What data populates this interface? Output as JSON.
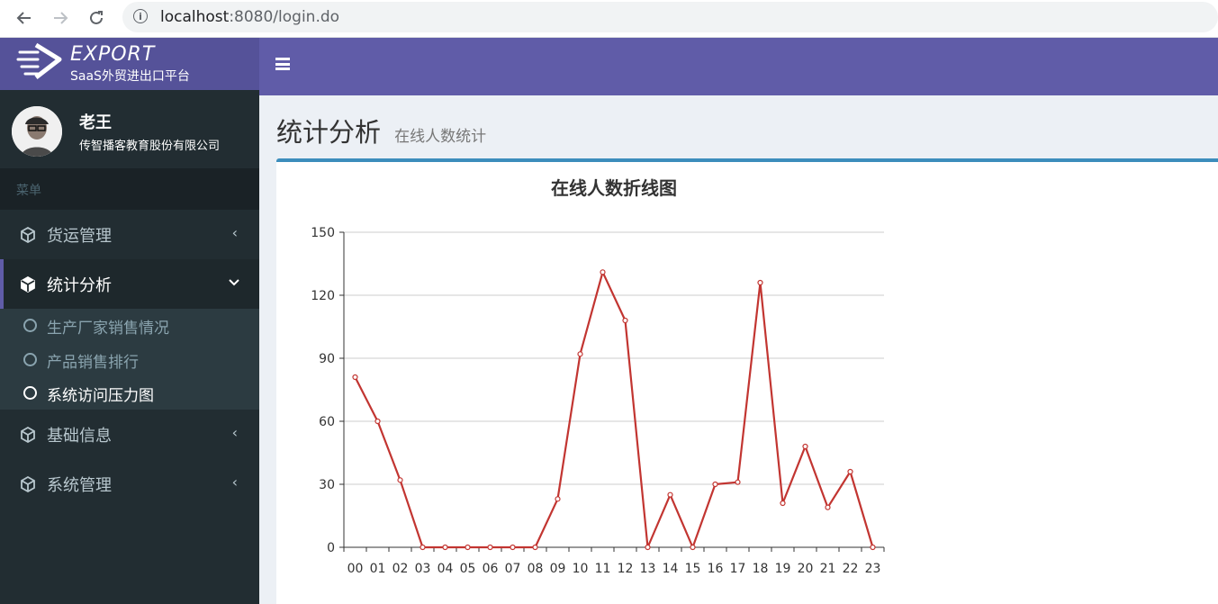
{
  "browser": {
    "url_host": "localhost",
    "url_rest": ":8080/login.do"
  },
  "header": {
    "logo_title": "EXPORT",
    "logo_subtitle": "SaaS外贸进出口平台"
  },
  "user": {
    "name": "老王",
    "company": "传智播客教育股份有限公司"
  },
  "sidebar": {
    "menu_header": "菜单",
    "items": [
      {
        "label": "货运管理",
        "icon": "cube-icon",
        "expanded": false
      },
      {
        "label": "统计分析",
        "icon": "cube-icon",
        "expanded": true
      },
      {
        "label": "基础信息",
        "icon": "cube-icon",
        "expanded": false
      },
      {
        "label": "系统管理",
        "icon": "cube-icon",
        "expanded": false
      }
    ],
    "subitems": [
      {
        "label": "生产厂家销售情况",
        "active": false
      },
      {
        "label": "产品销售排行",
        "active": false
      },
      {
        "label": "系统访问压力图",
        "active": true
      }
    ]
  },
  "page": {
    "title": "统计分析",
    "subtitle": "在线人数统计"
  },
  "colors": {
    "header": "#605ca8",
    "sidebar": "#222d32",
    "line": "#c23531",
    "box_accent": "#3c8dbc"
  },
  "chart_data": {
    "type": "line",
    "title": "在线人数折线图",
    "xlabel": "",
    "ylabel": "",
    "categories": [
      "00",
      "01",
      "02",
      "03",
      "04",
      "05",
      "06",
      "07",
      "08",
      "09",
      "10",
      "11",
      "12",
      "13",
      "14",
      "15",
      "16",
      "17",
      "18",
      "19",
      "20",
      "21",
      "22",
      "23"
    ],
    "values": [
      81,
      60,
      32,
      0,
      0,
      0,
      0,
      0,
      0,
      23,
      92,
      131,
      108,
      0,
      25,
      0,
      30,
      31,
      126,
      21,
      48,
      19,
      36,
      0
    ],
    "ylim": [
      0,
      150
    ],
    "yticks": [
      0,
      30,
      60,
      90,
      120,
      150
    ],
    "grid": true,
    "legend": "none"
  }
}
